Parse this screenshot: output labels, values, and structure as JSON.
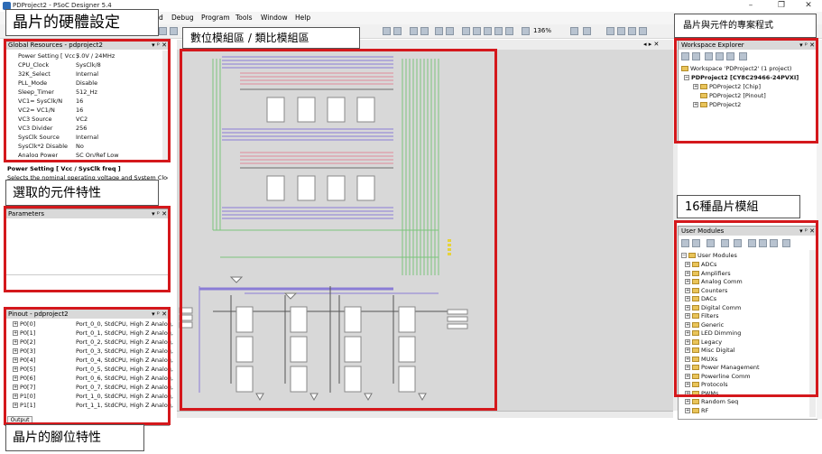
{
  "window": {
    "title": "PDProject2 - PSoC Designer 5.4",
    "controls": [
      "–",
      "❐",
      "✕"
    ]
  },
  "menu": [
    "d",
    "Debug",
    "Program",
    "Tools",
    "Window",
    "Help"
  ],
  "toolbar": {
    "zoom": "136%"
  },
  "global_resources": {
    "title": "Global Resources - pdproject2",
    "rows": [
      {
        "name": "Power Setting [ Vcc / ",
        "value": "5.0V / 24MHz"
      },
      {
        "name": "CPU_Clock",
        "value": "SysClk/8"
      },
      {
        "name": "32K_Select",
        "value": "Internal"
      },
      {
        "name": "PLL_Mode",
        "value": "Disable"
      },
      {
        "name": "Sleep_Timer",
        "value": "512_Hz"
      },
      {
        "name": "VC1= SysClk/N",
        "value": "16"
      },
      {
        "name": "VC2= VC1/N",
        "value": "16"
      },
      {
        "name": "VC3 Source",
        "value": "VC2"
      },
      {
        "name": "VC3 Divider",
        "value": "256"
      },
      {
        "name": "SysClk Source",
        "value": "Internal"
      },
      {
        "name": "SysClk*2 Disable",
        "value": "No"
      },
      {
        "name": "Analog Power",
        "value": "SC On/Ref Low"
      }
    ],
    "description_title": "Power Setting [ Vcc / SysClk freq ]",
    "description_text": "Selects the nominal operating voltage and System Clock"
  },
  "parameters": {
    "title": "Parameters"
  },
  "pinout": {
    "title": "Pinout - pdproject2",
    "rows": [
      {
        "name": "P0[0]",
        "value": "Port_0_0, StdCPU, High Z Analog,"
      },
      {
        "name": "P0[1]",
        "value": "Port_0_1, StdCPU, High Z Analog,"
      },
      {
        "name": "P0[2]",
        "value": "Port_0_2, StdCPU, High Z Analog,"
      },
      {
        "name": "P0[3]",
        "value": "Port_0_3, StdCPU, High Z Analog,"
      },
      {
        "name": "P0[4]",
        "value": "Port_0_4, StdCPU, High Z Analog,"
      },
      {
        "name": "P0[5]",
        "value": "Port_0_5, StdCPU, High Z Analog,"
      },
      {
        "name": "P0[6]",
        "value": "Port_0_6, StdCPU, High Z Analog,"
      },
      {
        "name": "P0[7]",
        "value": "Port_0_7, StdCPU, High Z Analog,"
      },
      {
        "name": "P1[0]",
        "value": "Port_1_0, StdCPU, High Z Analog,"
      },
      {
        "name": "P1[1]",
        "value": "Port_1_1, StdCPU, High Z Analog,"
      }
    ],
    "output_tab": "Output"
  },
  "workspace": {
    "title": "Workspace Explorer",
    "rows": [
      {
        "label": "Workspace 'PDProject2' (1 project)",
        "level": 0
      },
      {
        "label": "PDProject2 [CY8C29466-24PVXI]",
        "level": 1
      },
      {
        "label": "PDProject2 [Chip]",
        "level": 2
      },
      {
        "label": "PDProject2 [Pinout]",
        "level": 2
      },
      {
        "label": "PDProject2",
        "level": 2
      }
    ]
  },
  "user_modules": {
    "title": "User Modules",
    "root": "User Modules",
    "items": [
      "ADCs",
      "Amplifiers",
      "Analog Comm",
      "Counters",
      "DACs",
      "Digital Comm",
      "Filters",
      "Generic",
      "LED Dimming",
      "Legacy",
      "Misc Digital",
      "MUXs",
      "Power Management",
      "Powerline Comm",
      "Protocols",
      "PWMs",
      "Random Seq",
      "RF"
    ]
  },
  "annotations": {
    "chip_settings": "晶片的硬體設定",
    "selected_props": "選取的元件特性",
    "pin_props": "晶片的腳位特性",
    "blocks": "數位模組區 / 類比模組區",
    "project": "晶片與元件的專案程式",
    "modules": "16種晶片模組"
  },
  "colors": {
    "highlight": "#d4181c",
    "bus_violet": "#8a7cd6",
    "bus_green": "#7cc47c"
  }
}
